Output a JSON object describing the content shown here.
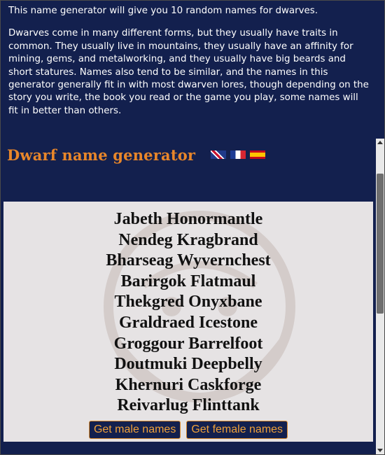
{
  "intro": {
    "line1": "This name generator will give you 10 random names for dwarves.",
    "paragraph2": "Dwarves come in many different forms, but they usually have traits in common. They usually live in mountains, they usually have an affinity for mining, gems, and metalworking, and they usually have big beards and short statures. Names also tend to be similar, and the names in this generator generally fit in with most dwarven lores, though depending on the story you write, the book you read or the game you play, some names will fit in better than others."
  },
  "generator": {
    "title": "Dwarf name generator",
    "flags": [
      "gb-flag-icon",
      "fr-flag-icon",
      "es-flag-icon"
    ],
    "names": [
      "Jabeth Honormantle",
      "Nendeg Kragbrand",
      "Bharseag Wyvernchest",
      "Barirgok Flatmaul",
      "Thekgred Onyxbane",
      "Graldraed Icestone",
      "Groggour Barrelfoot",
      "Doutmuki Deepbelly",
      "Khernuri Caskforge",
      "Reivarlug Flinttank"
    ],
    "buttons": {
      "male": "Get male names",
      "female": "Get female names"
    }
  },
  "colors": {
    "page_bg": "#13204e",
    "heading": "#e8862a",
    "panel_bg": "#e6e3e4",
    "button_text": "#f0a13a"
  }
}
